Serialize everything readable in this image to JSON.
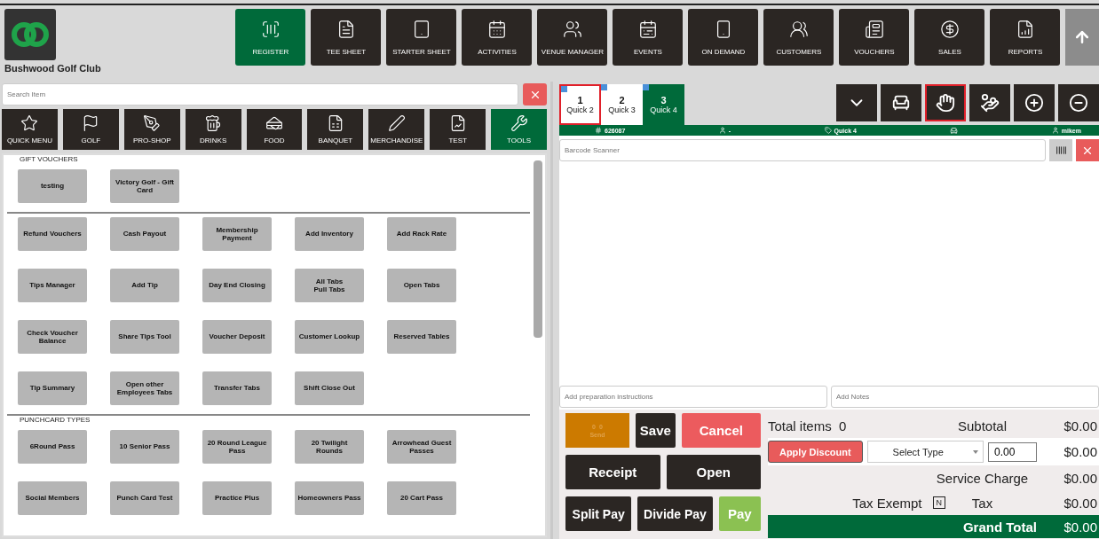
{
  "club": {
    "name": "Bushwood Golf Club"
  },
  "nav": [
    {
      "label": "REGISTER",
      "selected": true
    },
    {
      "label": "TEE SHEET",
      "selected": false
    },
    {
      "label": "STARTER SHEET",
      "selected": false
    },
    {
      "label": "ACTIVITIES",
      "selected": false
    },
    {
      "label": "VENUE MANAGER",
      "selected": false
    },
    {
      "label": "EVENTS",
      "selected": false
    },
    {
      "label": "ON DEMAND",
      "selected": false
    },
    {
      "label": "CUSTOMERS",
      "selected": false
    },
    {
      "label": "VOUCHERS",
      "selected": false
    },
    {
      "label": "SALES",
      "selected": false
    },
    {
      "label": "REPORTS",
      "selected": false
    }
  ],
  "search": {
    "placeholder": "Search Item"
  },
  "categories": [
    {
      "label": "QUICK MENU",
      "selected": false
    },
    {
      "label": "GOLF",
      "selected": false
    },
    {
      "label": "PRO-SHOP",
      "selected": false
    },
    {
      "label": "DRINKS",
      "selected": false
    },
    {
      "label": "FOOD",
      "selected": false
    },
    {
      "label": "BANQUET",
      "selected": false
    },
    {
      "label": "MERCHANDISE",
      "selected": false
    },
    {
      "label": "TEST",
      "selected": false
    },
    {
      "label": "TOOLS",
      "selected": true
    }
  ],
  "sections": [
    {
      "title": "GIFT VOUCHERS",
      "items": [
        "testing",
        "Victory Golf - Gift Card"
      ]
    },
    {
      "items": [
        "Refund Vouchers",
        "Cash Payout",
        "Membership Payment",
        "Add Inventory",
        "Add Rack Rate",
        "Tips Manager",
        "Add Tip",
        "Day End Closing",
        "All Tabs\nPull Tabs",
        "Open Tabs",
        "Check Voucher Balance",
        "Share Tips Tool",
        "Voucher Deposit",
        "Customer Lookup",
        "Reserved Tables",
        "Tip Summary",
        "Open other Employees Tabs",
        "Transfer Tabs",
        "Shift Close Out"
      ]
    },
    {
      "title": "PUNCHCARD TYPES",
      "items": [
        "6Round Pass",
        "10 Senior Pass",
        "20 Round League Pass",
        "20 Twilight Rounds",
        "Arrowhead Guest Passes",
        "Social Members",
        "Punch Card Test",
        "Practice Plus",
        "Homeowners Pass",
        "20 Cart Pass"
      ]
    }
  ],
  "order_tabs": [
    {
      "number": "1",
      "label": "Quick 2",
      "selected": false,
      "highlighted": true
    },
    {
      "number": "2",
      "label": "Quick 3",
      "selected": false,
      "highlighted": false
    },
    {
      "number": "3",
      "label": "Quick 4",
      "selected": true,
      "highlighted": false
    }
  ],
  "toolbar": [
    {
      "highlighted": false
    },
    {
      "highlighted": false
    },
    {
      "highlighted": true
    },
    {
      "highlighted": false
    },
    {
      "highlighted": false
    },
    {
      "highlighted": false
    }
  ],
  "info_bar": {
    "order_number": "626087",
    "customer": "-",
    "tab": "Quick 4",
    "user": "mikem"
  },
  "barcode": {
    "placeholder": "Barcode Scanner"
  },
  "prep": {
    "placeholder": "Add preparation instructions"
  },
  "notes": {
    "placeholder": "Add Notes"
  },
  "send": {
    "count_1": "0",
    "count_2": "0",
    "label": "Send",
    "disabled": true
  },
  "actions": {
    "save": "Save",
    "cancel": "Cancel",
    "receipt": "Receipt",
    "open": "Open",
    "split_pay": "Split Pay",
    "divide_pay": "Divide Pay",
    "pay": "Pay"
  },
  "summary": {
    "total_items_label": "Total items",
    "total_items": "0",
    "subtotal_label": "Subtotal",
    "subtotal": "$0.00",
    "discount_button": "Apply Discount",
    "discount_type": "Select Type",
    "discount_value": "0.00",
    "discount": "$0.00",
    "service_label": "Service Charge",
    "service": "$0.00",
    "tax_exempt_label": "Tax Exempt",
    "tax_exempt_value": "N",
    "tax_label": "Tax",
    "tax": "$0.00",
    "grand_label": "Grand Total",
    "grand": "$0.00"
  }
}
